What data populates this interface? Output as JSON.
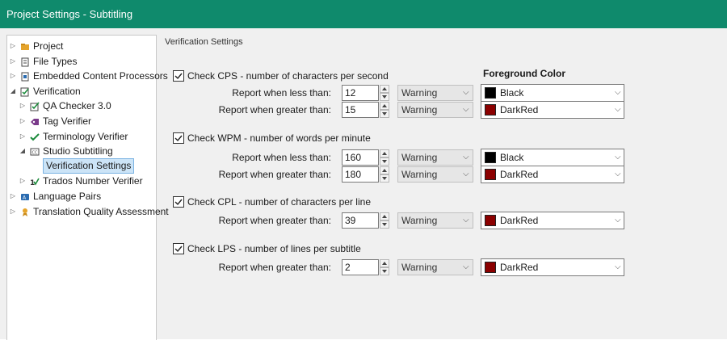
{
  "window": {
    "title": "Project Settings - Subtitling"
  },
  "tree": {
    "items": [
      {
        "label": "Project",
        "icon": "project-icon",
        "arrow": "▷",
        "level": 0
      },
      {
        "label": "File Types",
        "icon": "file-types-icon",
        "arrow": "▷",
        "level": 0
      },
      {
        "label": "Embedded Content Processors",
        "icon": "embedded-content-icon",
        "arrow": "▷",
        "level": 0
      },
      {
        "label": "Verification",
        "icon": "verification-icon",
        "arrow": "◢",
        "level": 0
      },
      {
        "label": "QA Checker 3.0",
        "icon": "qa-checker-icon",
        "arrow": "▷",
        "level": 1
      },
      {
        "label": "Tag Verifier",
        "icon": "tag-verifier-icon",
        "arrow": "▷",
        "level": 1
      },
      {
        "label": "Terminology Verifier",
        "icon": "terminology-verifier-icon",
        "arrow": "▷",
        "level": 1
      },
      {
        "label": "Studio Subtitling",
        "icon": "studio-subtitling-icon",
        "arrow": "◢",
        "level": 1
      },
      {
        "label": "Verification Settings",
        "icon": "",
        "arrow": "",
        "level": 2,
        "selected": true
      },
      {
        "label": "Trados Number Verifier",
        "icon": "number-verifier-icon",
        "arrow": "▷",
        "level": 1
      },
      {
        "label": "Language Pairs",
        "icon": "language-pairs-icon",
        "arrow": "▷",
        "level": 0
      },
      {
        "label": "Translation Quality Assessment",
        "icon": "tqa-icon",
        "arrow": "▷",
        "level": 0
      }
    ]
  },
  "panel": {
    "section_title": "Verification Settings",
    "foreground_header": "Foreground Color",
    "checks": [
      {
        "label": "Check CPS - number of characters per second",
        "checked": true,
        "rows": [
          {
            "label": "Report when less than:",
            "value": "12",
            "severity": "Warning",
            "color_name": "Black",
            "color": "#000000"
          },
          {
            "label": "Report when greater than:",
            "value": "15",
            "severity": "Warning",
            "color_name": "DarkRed",
            "color": "#8b0000"
          }
        ]
      },
      {
        "label": "Check WPM - number of words per minute",
        "checked": true,
        "rows": [
          {
            "label": "Report when less than:",
            "value": "160",
            "severity": "Warning",
            "color_name": "Black",
            "color": "#000000"
          },
          {
            "label": "Report when greater than:",
            "value": "180",
            "severity": "Warning",
            "color_name": "DarkRed",
            "color": "#8b0000"
          }
        ]
      },
      {
        "label": "Check CPL - number of characters per line",
        "checked": true,
        "rows": [
          {
            "label": "Report when greater than:",
            "value": "39",
            "severity": "Warning",
            "color_name": "DarkRed",
            "color": "#8b0000"
          }
        ]
      },
      {
        "label": "Check LPS - number of lines per subtitle",
        "checked": true,
        "rows": [
          {
            "label": "Report when greater than:",
            "value": "2",
            "severity": "Warning",
            "color_name": "DarkRed",
            "color": "#8b0000"
          }
        ]
      }
    ]
  },
  "colors": {
    "titlebar": "#0f8a6c",
    "selection": "#cce4f7"
  }
}
